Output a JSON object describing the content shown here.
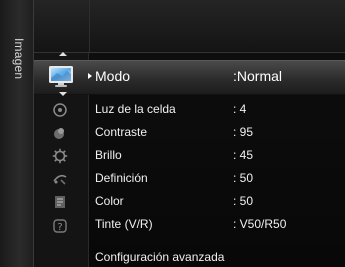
{
  "side_tab": {
    "label": "Imagen"
  },
  "selected": {
    "label": "Modo",
    "value": ":Normal"
  },
  "items": [
    {
      "label": "Luz de la celda",
      "value": ": 4"
    },
    {
      "label": "Contraste",
      "value": ": 95"
    },
    {
      "label": "Brillo",
      "value": ": 45"
    },
    {
      "label": "Definición",
      "value": ": 50"
    },
    {
      "label": "Color",
      "value": ": 50"
    },
    {
      "label": "Tinte (V/R)",
      "value": ": V50/R50"
    }
  ],
  "last_item": {
    "label": "Configuración avanzada"
  },
  "icons": [
    "picture-icon",
    "input-icon",
    "sound-icon",
    "setup-icon",
    "channel-icon",
    "application-icon",
    "help-icon"
  ]
}
